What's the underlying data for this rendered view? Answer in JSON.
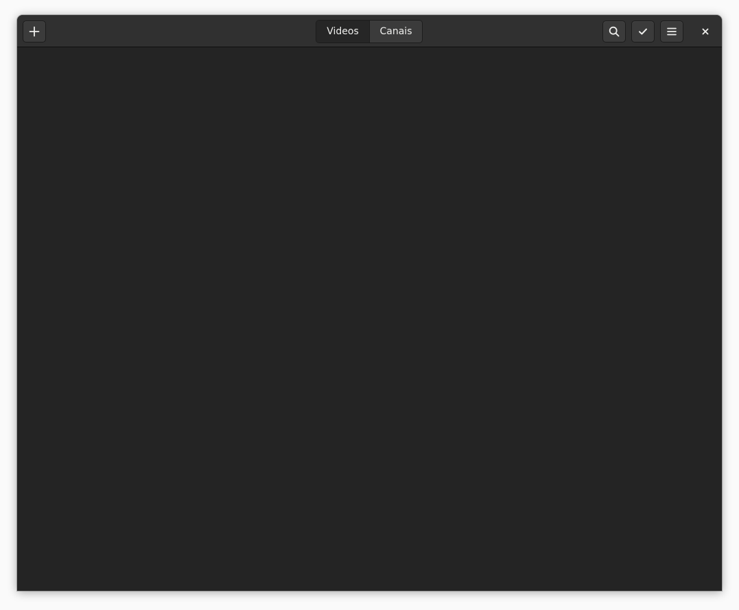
{
  "header": {
    "add_icon": "plus-icon",
    "tabs": [
      {
        "label": "Videos",
        "active": true
      },
      {
        "label": "Canais",
        "active": false
      }
    ],
    "search_icon": "search-icon",
    "select_icon": "checkmark-icon",
    "menu_icon": "hamburger-menu-icon",
    "close_icon": "close-icon"
  },
  "colors": {
    "window_bg": "#242424",
    "headerbar_bg": "#303030",
    "button_bg": "#3b3b3b",
    "active_tab_bg": "#262626",
    "text": "#eeeeec"
  }
}
